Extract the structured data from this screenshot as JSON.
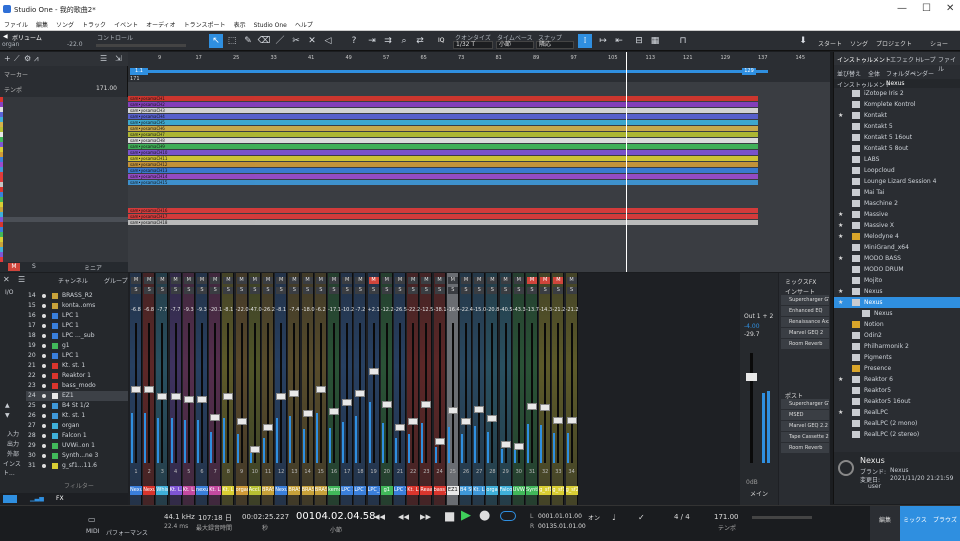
{
  "window": {
    "title": "Studio One - 我的歌曲2*"
  },
  "menu": [
    "ファイル",
    "編集",
    "ソング",
    "トラック",
    "イベント",
    "オーディオ",
    "トランスポート",
    "表示",
    "Studio One",
    "ヘルプ"
  ],
  "toolbar": {
    "volume_label": "ボリューム",
    "volume_value": "-22.0",
    "control_label": "コントロール",
    "track_name": "organ",
    "quantize_label": "クオンタイズ",
    "quantize_value": "1/32 T",
    "timebase_label": "タイムベース",
    "timebase_value": "小節",
    "snap_label": "スナップ",
    "snap_value": "隣応",
    "start_label": "スタート",
    "song_label": "ソング",
    "project_label": "プロジェクト",
    "show_label": "ショー",
    "iq_label": "IQ"
  },
  "left_panel": {
    "marker_label": "マーカー",
    "tempo_label": "テンポ",
    "tempo_value": "171.00",
    "tabs": [
      "M",
      "S",
      "ミニア"
    ]
  },
  "ruler": {
    "bars": [
      "9",
      "17",
      "25",
      "33",
      "41",
      "49",
      "57",
      "65",
      "73",
      "81",
      "89",
      "97",
      "105",
      "113",
      "121",
      "129",
      "137",
      "145"
    ],
    "tempo_marker": "171",
    "loop_start": "1.1",
    "loop_end": "129"
  },
  "arrange": {
    "tracks": [
      {
        "color": "#d9352d",
        "label": "sam•yosamaCH1"
      },
      {
        "color": "#8a3fc2",
        "label": "sam•yosamaCH2"
      },
      {
        "color": "#e0e0e0",
        "label": "sam•yosamaCH3"
      },
      {
        "color": "#5a63d8",
        "label": "sam•yosamaCH4"
      },
      {
        "color": "#3fb0d9",
        "label": "sam•yosamaCH5"
      },
      {
        "color": "#d4b24b",
        "label": "sam•yosamaCH6"
      },
      {
        "color": "#b6c032",
        "label": "sam•yosamaCH7"
      },
      {
        "color": "#e8e8e8",
        "label": "sam•yosamaCH8"
      },
      {
        "color": "#41b85a",
        "label": "sam•yosamaCH9"
      },
      {
        "color": "#7f55d6",
        "label": "sam•yosamaCH10"
      },
      {
        "color": "#d9ce34",
        "label": "sam•yosamaCH11"
      },
      {
        "color": "#cf9a38",
        "label": "sam•yosamaCH12"
      },
      {
        "color": "#3a7fdb",
        "label": "sam•yosamaCH13"
      },
      {
        "color": "#9b4ccf",
        "label": "sam•yosamaCH14"
      },
      {
        "color": "#3f98d8",
        "label": "sam•yosamaCH15"
      },
      {
        "color": "#e03b3b",
        "label": "sam•yosamaCH16"
      },
      {
        "color": "#e03b3b",
        "label": "sam•yosamaCH17"
      },
      {
        "color": "#c5c5c5",
        "label": "sam•yosamaCH18"
      }
    ]
  },
  "mixer_console": {
    "channel_label": "チャンネル",
    "group_label": "グループ",
    "filter_label": "フィルター",
    "side_labels": [
      "入力",
      "出力",
      "外部",
      "インスト..."
    ],
    "rows": [
      {
        "num": "14",
        "name": "BRASS_R2",
        "color": "#c8a23a"
      },
      {
        "num": "15",
        "name": "konta..oms",
        "color": "#c8a23a"
      },
      {
        "num": "16",
        "name": "LPC 1",
        "color": "#3a7fdb"
      },
      {
        "num": "17",
        "name": "LPC 1",
        "color": "#3a7fdb"
      },
      {
        "num": "18",
        "name": "LPC ..._sub",
        "color": "#3a7fdb"
      },
      {
        "num": "19",
        "name": "g1",
        "color": "#41b85a"
      },
      {
        "num": "20",
        "name": "LPC 1",
        "color": "#3a7fdb"
      },
      {
        "num": "21",
        "name": "Kt. st. 1",
        "color": "#d9352d"
      },
      {
        "num": "22",
        "name": "Reaktor 1",
        "color": "#d9352d"
      },
      {
        "num": "23",
        "name": "bass_modo",
        "color": "#d9352d"
      },
      {
        "num": "24",
        "name": "EZ1",
        "color": "#e8e8e8"
      },
      {
        "num": "25",
        "name": "B4 St 1/2",
        "color": "#3f98d8"
      },
      {
        "num": "26",
        "name": "Kt. st. 1",
        "color": "#3f98d8"
      },
      {
        "num": "27",
        "name": "organ",
        "color": "#3fb0d9"
      },
      {
        "num": "28",
        "name": "Falcon 1",
        "color": "#3fb0d9"
      },
      {
        "num": "29",
        "name": "UVWi..on 1",
        "color": "#41b85a"
      },
      {
        "num": "30",
        "name": "Synth...ne 3",
        "color": "#41b85a"
      },
      {
        "num": "31",
        "name": "g_sf1...11.6",
        "color": "#d9ce34"
      }
    ]
  },
  "mixer": {
    "strips": [
      {
        "name": "Nexus",
        "color": "#3a7fdb",
        "vol": "-6.8",
        "mute": false,
        "num": "1",
        "level": 0.55
      },
      {
        "name": "Nexus",
        "color": "#d9352d",
        "vol": "-6.8",
        "mute": false,
        "num": "2",
        "level": 0.55
      },
      {
        "name": "Whispers",
        "color": "#3fb0d9",
        "vol": "-7.7",
        "mute": false,
        "num": "3",
        "level": 0.5
      },
      {
        "name": "Kt. L. 1",
        "color": "#7f55d6",
        "vol": "-7.7",
        "mute": false,
        "num": "4",
        "level": 0.5
      },
      {
        "name": "Kt. L. 1",
        "color": "#c44aa0",
        "vol": "-9.3",
        "mute": false,
        "num": "5",
        "level": 0.48
      },
      {
        "name": "nexus",
        "color": "#3a7fdb",
        "vol": "-9.3",
        "mute": false,
        "num": "6",
        "level": 0.48
      },
      {
        "name": "Kt. L. 1",
        "color": "#c44aa0",
        "vol": "-20.1",
        "mute": false,
        "num": "7",
        "level": 0.35
      },
      {
        "name": "Kt. L. 2",
        "color": "#d9ce34",
        "vol": "-8.1",
        "mute": false,
        "num": "8",
        "level": 0.5
      },
      {
        "name": "organ",
        "color": "#cf9a38",
        "vol": "-22.0",
        "mute": false,
        "num": "9",
        "level": 0.32
      },
      {
        "name": "Accl.c",
        "color": "#b6c032",
        "vol": "-47.0",
        "mute": false,
        "num": "10",
        "level": 0.12
      },
      {
        "name": "BRASS",
        "color": "#c8a23a",
        "vol": "-26.2",
        "mute": false,
        "num": "11",
        "level": 0.28
      },
      {
        "name": "Nexus",
        "color": "#3a7fdb",
        "vol": "-8.1",
        "mute": false,
        "num": "12",
        "level": 0.5
      },
      {
        "name": "BRASS",
        "color": "#c8a23a",
        "vol": "-7.4",
        "mute": false,
        "num": "13",
        "level": 0.52
      },
      {
        "name": "BRASS",
        "color": "#c8a23a",
        "vol": "-18.0",
        "mute": false,
        "num": "14",
        "level": 0.38
      },
      {
        "name": "BRASS",
        "color": "#c8a23a",
        "vol": "-6.2",
        "mute": false,
        "num": "15",
        "level": 0.55
      },
      {
        "name": "kemota",
        "color": "#41b85a",
        "vol": "-17.1",
        "mute": false,
        "num": "16",
        "level": 0.39
      },
      {
        "name": "LPC 1",
        "color": "#3a7fdb",
        "vol": "-10.2",
        "mute": false,
        "num": "17",
        "level": 0.46
      },
      {
        "name": "LPC 1",
        "color": "#3a7fdb",
        "vol": "-7.2",
        "mute": false,
        "num": "18",
        "level": 0.52
      },
      {
        "name": "LPC_s",
        "color": "#3a7fdb",
        "vol": "+2.1",
        "mute": true,
        "num": "19",
        "level": 0.68
      },
      {
        "name": "g1",
        "color": "#41b85a",
        "vol": "-12.2",
        "mute": false,
        "num": "20",
        "level": 0.44
      },
      {
        "name": "LPC 1",
        "color": "#3a7fdb",
        "vol": "-26.5",
        "mute": false,
        "num": "21",
        "level": 0.28
      },
      {
        "name": "Kt. L. 1",
        "color": "#d9352d",
        "vol": "-22.2",
        "mute": false,
        "num": "22",
        "level": 0.32
      },
      {
        "name": "Reaal",
        "color": "#d9352d",
        "vol": "-12.5",
        "mute": false,
        "num": "23",
        "level": 0.44
      },
      {
        "name": "bass_m",
        "color": "#d9352d",
        "vol": "-38.1",
        "mute": false,
        "num": "24",
        "level": 0.18
      },
      {
        "name": "EZ1",
        "color": "#e8e8e8",
        "vol": "-16.4",
        "mute": false,
        "num": "25",
        "level": 0.4
      },
      {
        "name": "B4 St 1/2",
        "color": "#3f98d8",
        "vol": "-22.4",
        "mute": false,
        "num": "26",
        "level": 0.32
      },
      {
        "name": "Kt. L. 1",
        "color": "#3f98d8",
        "vol": "-15.0",
        "mute": false,
        "num": "27",
        "level": 0.41
      },
      {
        "name": "organ",
        "color": "#3fb0d9",
        "vol": "-20.8",
        "mute": false,
        "num": "28",
        "level": 0.34
      },
      {
        "name": "Falcon",
        "color": "#3fb0d9",
        "vol": "-40.5",
        "mute": false,
        "num": "29",
        "level": 0.16
      },
      {
        "name": "UVWi",
        "color": "#41b85a",
        "vol": "-43.3",
        "mute": false,
        "num": "30",
        "level": 0.14
      },
      {
        "name": "Synthe",
        "color": "#41b85a",
        "vol": "-13.7",
        "mute": true,
        "num": "31",
        "level": 0.43
      },
      {
        "name": "g_sf1",
        "color": "#d9ce34",
        "vol": "-14.3",
        "mute": true,
        "num": "32",
        "level": 0.42
      },
      {
        "name": "g_sf1",
        "color": "#d9ce34",
        "vol": "-21.2",
        "mute": true,
        "num": "33",
        "level": 0.33
      },
      {
        "name": "g_sf2",
        "color": "#d9ce34",
        "vol": "-21.2",
        "mute": false,
        "num": "34",
        "level": 0.33
      }
    ],
    "out_label": "Out 1 + 2",
    "out_vol_a": "-4.00",
    "out_vol_b": "-29.7",
    "main_label": "メイン",
    "main_db": "0dB",
    "insert_label": "インサート",
    "inserts": [
      "Supercharger GT",
      "Enhanced EQ",
      "Renaissance Axx",
      "Marvel GEQ 2",
      "Room Reverb"
    ],
    "post_label": "ポスト",
    "posts": [
      "Supercharger GT",
      "MSED",
      "Marvel GEQ 2.2",
      "Tape Cassette 2",
      "Room Reverb"
    ],
    "mixfx_label": "ミックスFX"
  },
  "browser": {
    "tabs": [
      "インストゥルメント",
      "エフェクト",
      "ループ",
      "ファイル"
    ],
    "sort_label": "並び替え",
    "sort_all": "全体",
    "sort_folder": "フォルダー",
    "sort_vendor": "ベンダー",
    "path": [
      "インストゥルメント",
      "Nexus"
    ],
    "items": [
      {
        "name": "iZotope Iris 2",
        "star": false,
        "gold": false
      },
      {
        "name": "Komplete Kontrol",
        "star": false,
        "gold": false
      },
      {
        "name": "Kontakt",
        "star": true,
        "gold": false
      },
      {
        "name": "Kontakt 5",
        "star": false,
        "gold": false
      },
      {
        "name": "Kontakt 5 16out",
        "star": false,
        "gold": false
      },
      {
        "name": "Kontakt 5 8out",
        "star": false,
        "gold": false
      },
      {
        "name": "LABS",
        "star": false,
        "gold": false
      },
      {
        "name": "Loopcloud",
        "star": false,
        "gold": false
      },
      {
        "name": "Lounge Lizard Session 4",
        "star": false,
        "gold": false
      },
      {
        "name": "Mai Tai",
        "star": false,
        "gold": false
      },
      {
        "name": "Maschine 2",
        "star": false,
        "gold": false
      },
      {
        "name": "Massive",
        "star": true,
        "gold": false
      },
      {
        "name": "Massive X",
        "star": true,
        "gold": false
      },
      {
        "name": "Melodyne 4",
        "star": true,
        "gold": true
      },
      {
        "name": "MiniGrand_x64",
        "star": false,
        "gold": false
      },
      {
        "name": "MODO BASS",
        "star": true,
        "gold": false
      },
      {
        "name": "MODO DRUM",
        "star": false,
        "gold": false
      },
      {
        "name": "Mojito",
        "star": false,
        "gold": false
      },
      {
        "name": "Nexus",
        "star": true,
        "gold": false
      },
      {
        "name": "Nexus",
        "star": true,
        "gold": false,
        "selected": true
      },
      {
        "name": "Nexus",
        "star": false,
        "gold": false,
        "child": true
      },
      {
        "name": "Notion",
        "star": false,
        "gold": true
      },
      {
        "name": "Odin2",
        "star": false,
        "gold": false
      },
      {
        "name": "Philharmonik 2",
        "star": false,
        "gold": false
      },
      {
        "name": "Pigments",
        "star": false,
        "gold": false
      },
      {
        "name": "Presence",
        "star": false,
        "gold": true
      },
      {
        "name": "Reaktor 6",
        "star": true,
        "gold": false
      },
      {
        "name": "Reaktor5",
        "star": false,
        "gold": false
      },
      {
        "name": "Reaktor5 16out",
        "star": false,
        "gold": false
      },
      {
        "name": "RealLPC",
        "star": true,
        "gold": false
      },
      {
        "name": "RealLPC (2 mono)",
        "star": false,
        "gold": false
      },
      {
        "name": "RealLPC (2 stereo)",
        "star": false,
        "gold": false
      }
    ],
    "info_title": "Nexus",
    "info_vendor_label": "ブランド:",
    "info_vendor": "Nexus",
    "info_date_label": "変更日:",
    "info_date": "2021/11/20 21:21:59",
    "info_type": "user"
  },
  "transport": {
    "midi_label": "MIDI",
    "perf_label": "パフォーマンス",
    "sample_rate": "44.1 kHz",
    "latency": "22.4 ms",
    "time_day": "107:18 日",
    "time_day_sub": "最大録音時間",
    "seconds": "00:02:25.227",
    "seconds_sub": "秒",
    "position": "00104.02.04.58",
    "position_sub": "小節",
    "loop_l": "0001.01.01.00",
    "loop_r": "00135.01.01.00",
    "metronome_label": "オン",
    "signature": "4 / 4",
    "tempo": "171.00",
    "tempo_label": "テンポ",
    "edit_label": "編集",
    "mix_label": "ミックス",
    "browse_label": "ブラウズ"
  }
}
